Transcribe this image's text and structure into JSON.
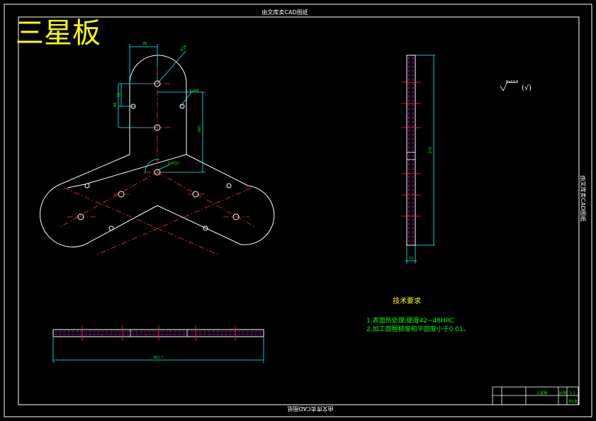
{
  "title": "三星板",
  "frame_text_top": "由文库卖CAD图纸",
  "frame_text_bottom": "由文库卖CAD图纸",
  "frame_text_right": "由文库卖CAD图纸",
  "dims": {
    "top_width": "28",
    "radius_top": "R28",
    "left_small": "18",
    "left_big": "48",
    "hole_small": "4xM8",
    "vertical": "165",
    "center": "7xM10",
    "bottom_length": "301.7",
    "side_height": "370",
    "side_width": "12"
  },
  "roughness": {
    "value": "Ra12.5",
    "mark": "(√)"
  },
  "tech_req": {
    "title": "技术要求",
    "line1": "1.表面热处理,硬度42~48HRC",
    "line2": "2.加工面粗糙度和平面度小于0.01。"
  },
  "title_block": {
    "label_a": "三星板",
    "label_b": "比例",
    "scale": "1:1",
    "sheet": "共1张"
  },
  "colors": {
    "outline": "#ffffff",
    "dimension": "#00ffff",
    "centerline": "#ff3030",
    "hidden": "#ff00ff",
    "text_yellow": "#ffff00",
    "text_green": "#00ff00"
  }
}
